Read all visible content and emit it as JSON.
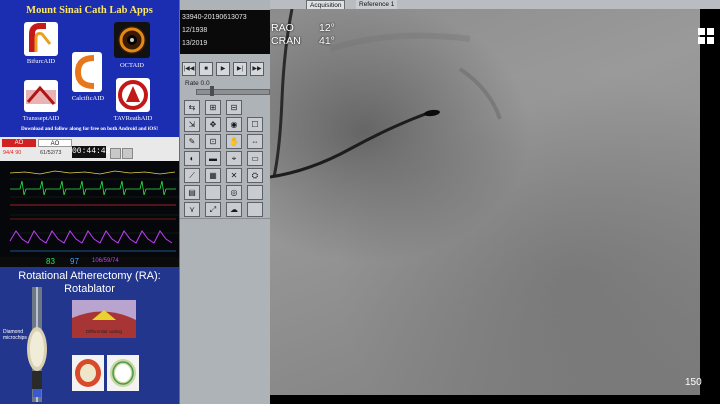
{
  "promo": {
    "title": "Mount Sinai Cath Lab Apps",
    "apps": [
      {
        "label": "BifurcAID",
        "icon": "bifurcation-app-icon"
      },
      {
        "label": "OCTAID",
        "icon": "oct-app-icon"
      },
      {
        "label": "CalcificAID",
        "icon": "calcification-app-icon"
      },
      {
        "label": "TransseptAID",
        "icon": "transseptal-app-icon"
      },
      {
        "label": "TAVReathAID",
        "icon": "tavr-app-icon"
      }
    ],
    "footer": "Download and follow along for free on both Android and iOS!"
  },
  "monitor": {
    "tab_ao_left": "AO",
    "tab_ao_right": "AO",
    "left_value": "94/4 90",
    "right_value": "61/52/73",
    "time": "00:44:42",
    "footer_hr": "83",
    "footer_spo2": "97",
    "footer_bp": "106/59/74",
    "colors": {
      "ecg": "#2ee64a",
      "pressure": "#c43cff",
      "alarm": "#e02020"
    }
  },
  "slide": {
    "title": "Rotational Atherectomy (RA): Rotablator",
    "diamond_label": "Diamond microchips",
    "diff_label": "Differential cutting"
  },
  "patient": {
    "line1": "33940-20190613073",
    "line2": "12/1938",
    "line3": "13/2019"
  },
  "playback": {
    "buttons": [
      "|◀◀",
      "■",
      "▶",
      "▶|",
      "▶▶"
    ],
    "rate_label": "Rate  0.0",
    "rate_value": 0.0
  },
  "tools": [
    [
      "⇆",
      "⊞",
      "⊟"
    ],
    [
      "⇲",
      "✥",
      "◉",
      "☐"
    ],
    [
      "✎",
      "⊡",
      "✋",
      "⇔"
    ],
    [
      "◐",
      "▬",
      "⌖",
      "▭"
    ],
    [
      "⟋",
      "▦",
      "✕",
      "⛭"
    ],
    [
      "▤",
      "",
      "◎",
      ""
    ],
    [
      "⋎",
      "⤢",
      "☁",
      ""
    ]
  ],
  "viewer": {
    "tabs": [
      "Acquisition",
      "Reference 1"
    ],
    "rao_label": "RAO",
    "rao_value": "12°",
    "cran_label": "CRAN",
    "cran_value": "41°",
    "frame": "150"
  }
}
